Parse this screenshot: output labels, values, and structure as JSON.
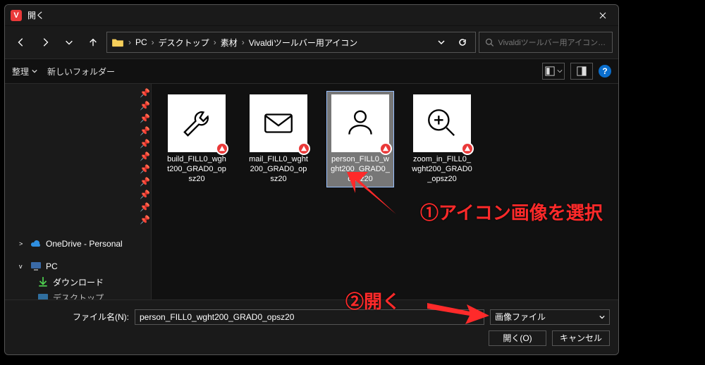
{
  "window": {
    "title": "開く",
    "app_icon_letter": "V"
  },
  "nav": {
    "crumbs": [
      "PC",
      "デスクトップ",
      "素材",
      "Vivaldiツールバー用アイコン"
    ],
    "search_placeholder": "Vivaldiツールバー用アイコンの検..."
  },
  "toolbar": {
    "organize": "整理",
    "new_folder": "新しいフォルダー"
  },
  "sidebar": {
    "items": [
      {
        "label": "OneDrive - Personal",
        "icon": "cloud",
        "collapse": ">"
      },
      {
        "label": "PC",
        "icon": "pc",
        "collapse": "v"
      },
      {
        "label": "ダウンロード",
        "icon": "download",
        "indent": true
      },
      {
        "label": "デスクトップ",
        "icon": "desktop",
        "indent": true
      }
    ]
  },
  "files": [
    {
      "name": "build_FILL0_wght200_GRAD0_opsz20",
      "icon": "wrench",
      "selected": false
    },
    {
      "name": "mail_FILL0_wght200_GRAD0_opsz20",
      "icon": "mail",
      "selected": false
    },
    {
      "name": "person_FILL0_wght200_GRAD0_opsz20",
      "icon": "person",
      "selected": true
    },
    {
      "name": "zoom_in_FILL0_wght200_GRAD0_opsz20",
      "icon": "zoom-in",
      "selected": false
    }
  ],
  "bottom": {
    "filename_label": "ファイル名(N):",
    "filename_value": "person_FILL0_wght200_GRAD0_opsz20",
    "filetype_label": "画像ファイル",
    "open_label": "開く(O)",
    "cancel_label": "キャンセル"
  },
  "annotations": {
    "step1": "①アイコン画像を選択",
    "step2": "②開く"
  }
}
